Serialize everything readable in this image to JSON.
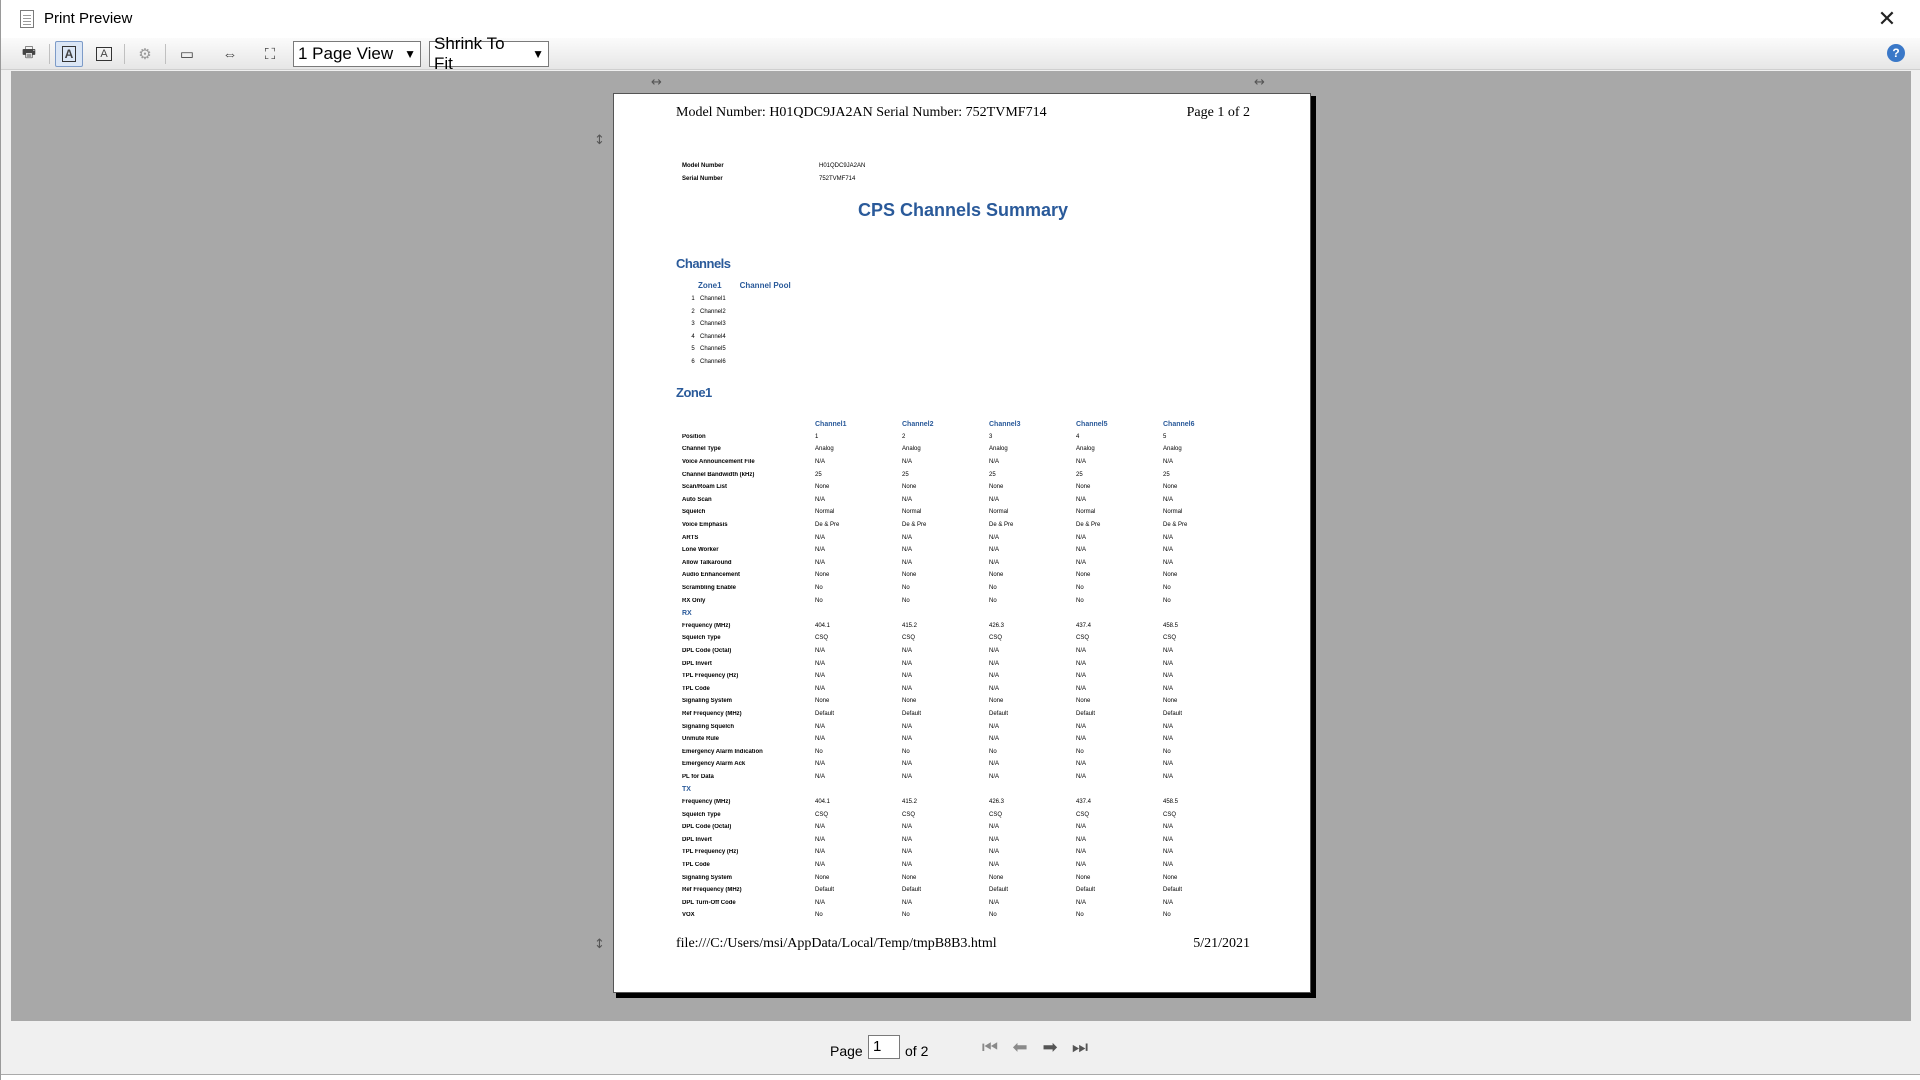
{
  "window": {
    "title": "Print Preview"
  },
  "toolbar": {
    "view_mode": "1 Page View",
    "zoom_mode": "Shrink To Fit",
    "icons": [
      "printer-icon",
      "portrait-icon",
      "landscape-icon",
      "page-setup-icon",
      "fit-page-icon",
      "fit-width-icon",
      "full-size-icon",
      "help-icon"
    ]
  },
  "page": {
    "header_left": "Model Number: H01QDC9JA2AN Serial Number: 752TVMF714",
    "header_right": "Page 1 of 2",
    "footer_left": "file:///C:/Users/msi/AppData/Local/Temp/tmpB8B3.html",
    "footer_right": "5/21/2021",
    "meta": [
      {
        "key": "Model Number",
        "value": "H01QDC9JA2AN"
      },
      {
        "key": "Serial Number",
        "value": "752TVMF714"
      }
    ],
    "title": "CPS Channels Summary",
    "channels_heading": "Channels",
    "channels_cols": [
      "Zone1",
      "Channel Pool"
    ],
    "channels": [
      {
        "n": "1",
        "name": "Channel1"
      },
      {
        "n": "2",
        "name": "Channel2"
      },
      {
        "n": "3",
        "name": "Channel3"
      },
      {
        "n": "4",
        "name": "Channel4"
      },
      {
        "n": "5",
        "name": "Channel5"
      },
      {
        "n": "6",
        "name": "Channel6"
      }
    ],
    "zone_heading": "Zone1",
    "zone_columns": [
      "Channel1",
      "Channel2",
      "Channel3",
      "Channel5",
      "Channel6"
    ],
    "zone_rows": [
      {
        "label": "Position",
        "values": [
          "1",
          "2",
          "3",
          "4",
          "5"
        ]
      },
      {
        "label": "Channel Type",
        "values": [
          "Analog",
          "Analog",
          "Analog",
          "Analog",
          "Analog"
        ]
      },
      {
        "label": "Voice Announcement File",
        "values": [
          "N/A",
          "N/A",
          "N/A",
          "N/A",
          "N/A"
        ]
      },
      {
        "label": "Channel Bandwidth (kHz)",
        "values": [
          "25",
          "25",
          "25",
          "25",
          "25"
        ]
      },
      {
        "label": "Scan/Roam List",
        "values": [
          "None",
          "None",
          "None",
          "None",
          "None"
        ]
      },
      {
        "label": "Auto Scan",
        "values": [
          "N/A",
          "N/A",
          "N/A",
          "N/A",
          "N/A"
        ]
      },
      {
        "label": "Squelch",
        "values": [
          "Normal",
          "Normal",
          "Normal",
          "Normal",
          "Normal"
        ]
      },
      {
        "label": "Voice Emphasis",
        "values": [
          "De & Pre",
          "De & Pre",
          "De & Pre",
          "De & Pre",
          "De & Pre"
        ]
      },
      {
        "label": "ARTS",
        "values": [
          "N/A",
          "N/A",
          "N/A",
          "N/A",
          "N/A"
        ]
      },
      {
        "label": "Lone Worker",
        "values": [
          "N/A",
          "N/A",
          "N/A",
          "N/A",
          "N/A"
        ]
      },
      {
        "label": "Allow Talkaround",
        "values": [
          "N/A",
          "N/A",
          "N/A",
          "N/A",
          "N/A"
        ]
      },
      {
        "label": "Audio Enhancement",
        "values": [
          "None",
          "None",
          "None",
          "None",
          "None"
        ]
      },
      {
        "label": "Scrambling Enable",
        "values": [
          "No",
          "No",
          "No",
          "No",
          "No"
        ]
      },
      {
        "label": "RX Only",
        "values": [
          "No",
          "No",
          "No",
          "No",
          "No"
        ]
      },
      {
        "sub": "RX"
      },
      {
        "label": "Frequency (MHz)",
        "values": [
          "404.1",
          "415.2",
          "426.3",
          "437.4",
          "458.5"
        ]
      },
      {
        "label": "Squelch Type",
        "values": [
          "CSQ",
          "CSQ",
          "CSQ",
          "CSQ",
          "CSQ"
        ]
      },
      {
        "label": "DPL Code (Octal)",
        "values": [
          "N/A",
          "N/A",
          "N/A",
          "N/A",
          "N/A"
        ]
      },
      {
        "label": "DPL Invert",
        "values": [
          "N/A",
          "N/A",
          "N/A",
          "N/A",
          "N/A"
        ]
      },
      {
        "label": "TPL Frequency (Hz)",
        "values": [
          "N/A",
          "N/A",
          "N/A",
          "N/A",
          "N/A"
        ]
      },
      {
        "label": "TPL Code",
        "values": [
          "N/A",
          "N/A",
          "N/A",
          "N/A",
          "N/A"
        ]
      },
      {
        "label": "Signaling System",
        "values": [
          "None",
          "None",
          "None",
          "None",
          "None"
        ]
      },
      {
        "label": "Ref Frequency (MHz)",
        "values": [
          "Default",
          "Default",
          "Default",
          "Default",
          "Default"
        ]
      },
      {
        "label": "Signaling Squelch",
        "values": [
          "N/A",
          "N/A",
          "N/A",
          "N/A",
          "N/A"
        ]
      },
      {
        "label": "Unmute Rule",
        "values": [
          "N/A",
          "N/A",
          "N/A",
          "N/A",
          "N/A"
        ]
      },
      {
        "label": "Emergency Alarm Indication",
        "values": [
          "No",
          "No",
          "No",
          "No",
          "No"
        ]
      },
      {
        "label": "Emergency Alarm Ack",
        "values": [
          "N/A",
          "N/A",
          "N/A",
          "N/A",
          "N/A"
        ]
      },
      {
        "label": "PL for Data",
        "values": [
          "N/A",
          "N/A",
          "N/A",
          "N/A",
          "N/A"
        ]
      },
      {
        "sub": "TX"
      },
      {
        "label": "Frequency (MHz)",
        "values": [
          "404.1",
          "415.2",
          "426.3",
          "437.4",
          "458.5"
        ]
      },
      {
        "label": "Squelch Type",
        "values": [
          "CSQ",
          "CSQ",
          "CSQ",
          "CSQ",
          "CSQ"
        ]
      },
      {
        "label": "DPL Code (Octal)",
        "values": [
          "N/A",
          "N/A",
          "N/A",
          "N/A",
          "N/A"
        ]
      },
      {
        "label": "DPL Invert",
        "values": [
          "N/A",
          "N/A",
          "N/A",
          "N/A",
          "N/A"
        ]
      },
      {
        "label": "TPL Frequency (Hz)",
        "values": [
          "N/A",
          "N/A",
          "N/A",
          "N/A",
          "N/A"
        ]
      },
      {
        "label": "TPL Code",
        "values": [
          "N/A",
          "N/A",
          "N/A",
          "N/A",
          "N/A"
        ]
      },
      {
        "label": "Signaling System",
        "values": [
          "None",
          "None",
          "None",
          "None",
          "None"
        ]
      },
      {
        "label": "Ref Frequency (MHz)",
        "values": [
          "Default",
          "Default",
          "Default",
          "Default",
          "Default"
        ]
      },
      {
        "label": "DPL Turn-Off Code",
        "values": [
          "N/A",
          "N/A",
          "N/A",
          "N/A",
          "N/A"
        ]
      },
      {
        "label": "VOX",
        "values": [
          "No",
          "No",
          "No",
          "No",
          "No"
        ]
      }
    ]
  },
  "navigation": {
    "page_label": "Page",
    "current_page": "1",
    "of_label": "of 2"
  },
  "colors": {
    "accent": "#2a5a9a",
    "preview_bg": "#a8a8a8"
  }
}
